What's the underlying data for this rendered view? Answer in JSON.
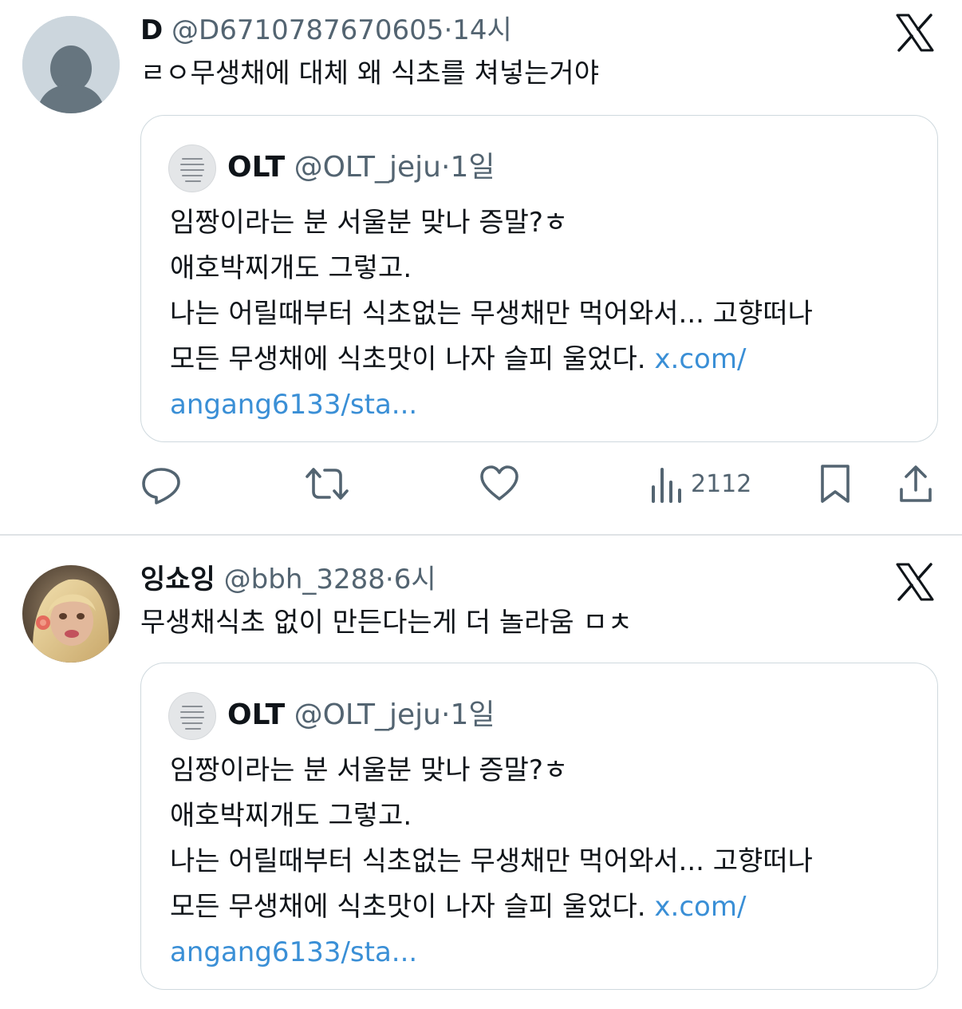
{
  "tweets": [
    {
      "author": {
        "name": "D",
        "handle": "@D6710787670605"
      },
      "dot": "·",
      "time": "14시",
      "text": "ㄹㅇ무생채에 대체 왜 식초를 쳐넣는거야",
      "quote": {
        "author": {
          "name": "OLT",
          "handle": "@OLT_jeju"
        },
        "dot": "·",
        "time": "1일",
        "lines": [
          "임짱이라는 분 서울분 맞나 증말?ㅎ",
          "애호박찌개도 그렇고.",
          "나는 어릴때부터 식초없는 무생채만 먹어와서... 고향떠나",
          "모든 무생채에 식초맛이 나자 슬피 울었다. "
        ],
        "link_part1": "x.com/",
        "link_part2": "angang6133/sta..."
      },
      "actions": {
        "reply_icon": "reply-icon",
        "retweet_icon": "retweet-icon",
        "like_icon": "heart-icon",
        "views_icon": "views-icon",
        "views_count": "2112",
        "bookmark_icon": "bookmark-icon",
        "share_icon": "share-icon"
      }
    },
    {
      "author": {
        "name": "잉쇼잉",
        "handle": "@bbh_3288"
      },
      "dot": "·",
      "time": "6시",
      "text": "무생채식초 없이 만든다는게 더 놀라움 ㅁㅊ",
      "quote": {
        "author": {
          "name": "OLT",
          "handle": "@OLT_jeju"
        },
        "dot": "·",
        "time": "1일",
        "lines": [
          "임짱이라는 분 서울분 맞나 증말?ㅎ",
          "애호박찌개도 그렇고.",
          "나는 어릴때부터 식초없는 무생채만 먹어와서... 고향떠나",
          "모든 무생채에 식초맛이 나자 슬피 울었다. "
        ],
        "link_part1": "x.com/",
        "link_part2": "angang6133/sta..."
      }
    }
  ],
  "colors": {
    "text": "#0f1419",
    "secondary": "#536471",
    "link": "#3a8fd6",
    "border": "#cfd9de"
  }
}
